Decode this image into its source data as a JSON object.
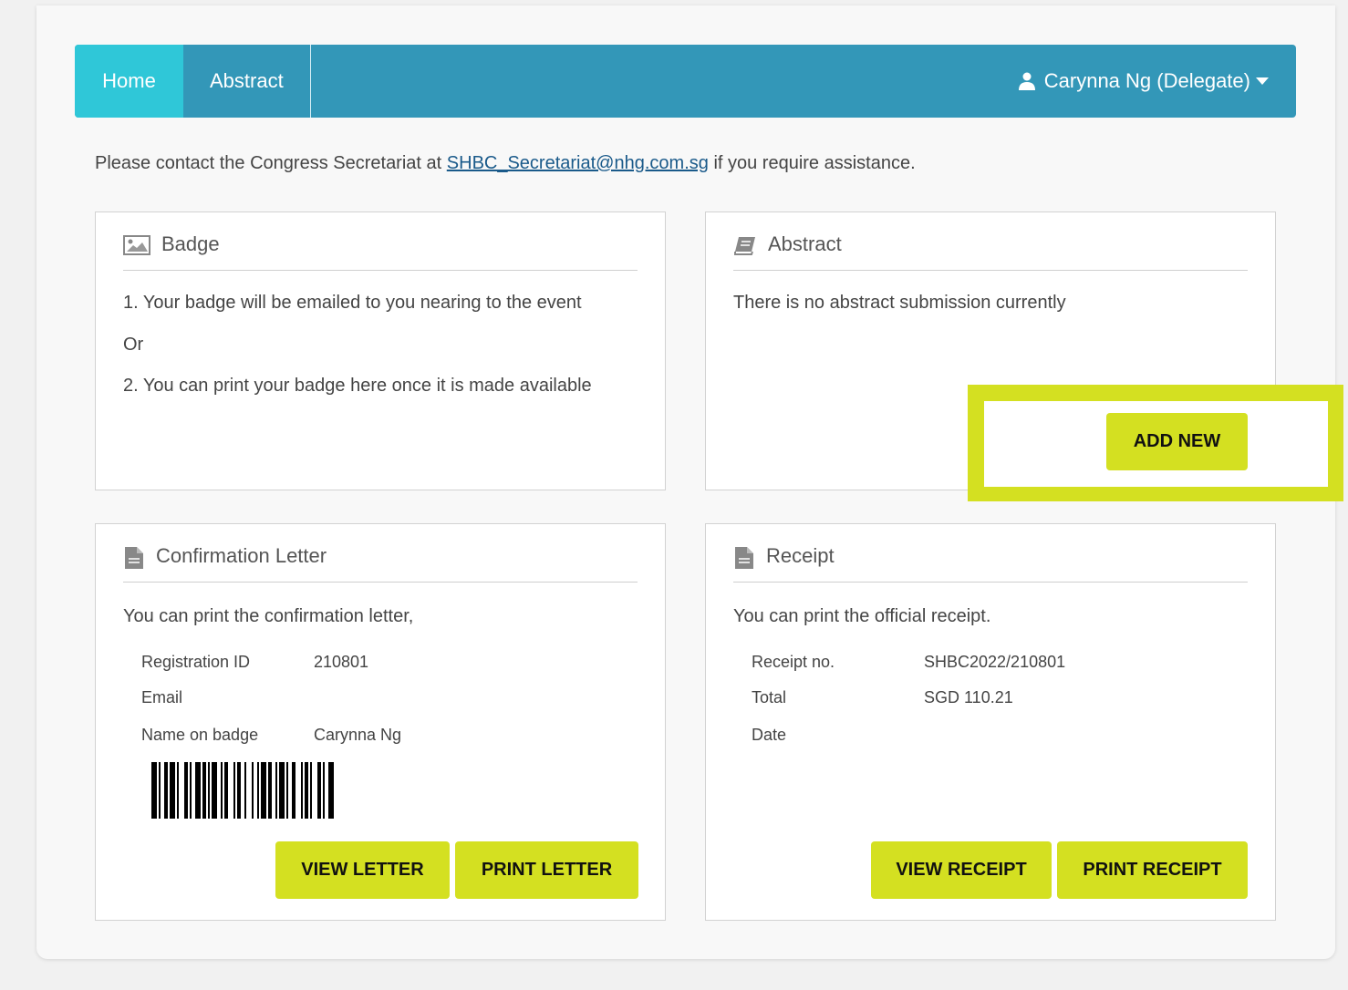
{
  "nav": {
    "tabs": [
      {
        "label": "Home",
        "active": true
      },
      {
        "label": "Abstract",
        "active": false
      }
    ],
    "user_label": "Carynna Ng (Delegate)",
    "color": "#3397b8",
    "active_color": "#2fc7d8"
  },
  "contact": {
    "prefix": "Please contact the Congress Secretariat at",
    "email": "SHBC_Secretariat@nhg.com.sg",
    "suffix": "if you require assistance."
  },
  "badge": {
    "title": "Badge",
    "icon": "image-icon",
    "line1": "1. Your badge will be emailed to you nearing to the event",
    "line2": "Or",
    "line3": "2. You can print your badge here once it is made available"
  },
  "abstract": {
    "title": "Abstract",
    "icon": "book-icon",
    "message": "There is no abstract submission currently",
    "add_label": "ADD NEW"
  },
  "confirmation": {
    "title": "Confirmation Letter",
    "icon": "document-icon",
    "intro": "You can print the confirmation letter,",
    "rows": [
      {
        "label": "Registration ID",
        "value": "210801"
      },
      {
        "label": "Email",
        "value": ""
      },
      {
        "label": "Name on badge",
        "value": "Carynna Ng"
      }
    ],
    "view_label": "VIEW LETTER",
    "print_label": "PRINT LETTER"
  },
  "receipt": {
    "title": "Receipt",
    "icon": "document-icon",
    "intro": "You can print the official receipt.",
    "rows": [
      {
        "label": "Receipt no.",
        "value": "SHBC2022/210801"
      },
      {
        "label": "Total",
        "value": "SGD 110.21"
      },
      {
        "label": "Date",
        "value": ""
      }
    ],
    "view_label": "VIEW RECEIPT",
    "print_label": "PRINT RECEIPT"
  },
  "accent_color": "#d4e021"
}
